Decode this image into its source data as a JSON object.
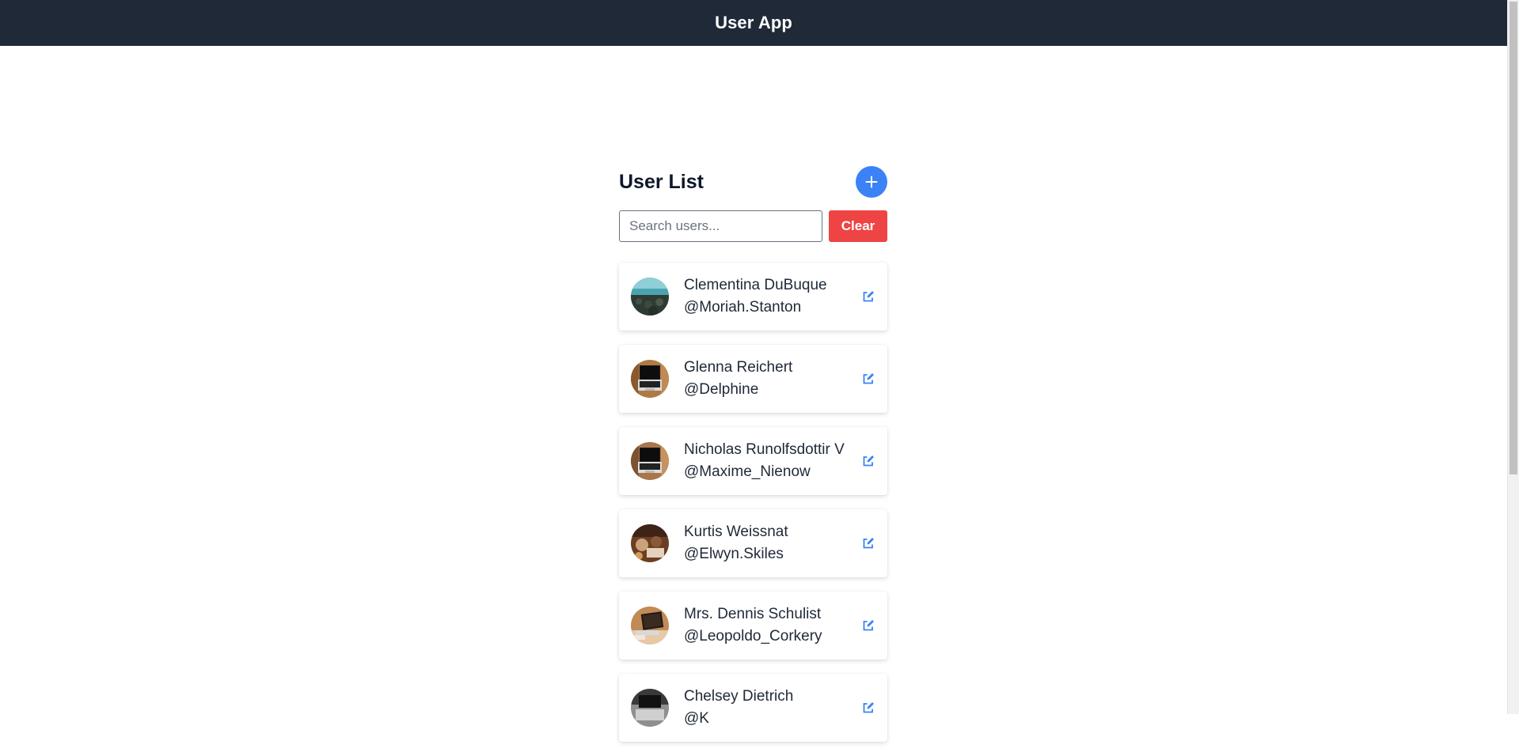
{
  "header": {
    "title": "User App"
  },
  "main": {
    "title": "User List",
    "add_label": "+",
    "search": {
      "placeholder": "Search users...",
      "value": ""
    },
    "clear_label": "Clear",
    "users": [
      {
        "name": "Clementina DuBuque",
        "handle": "@Moriah.Stanton",
        "avatar": "landscape-photo"
      },
      {
        "name": "Glenna Reichert",
        "handle": "@Delphine",
        "avatar": "laptop-photo"
      },
      {
        "name": "Nicholas Runolfsdottir V",
        "handle": "@Maxime_Nienow",
        "avatar": "laptop-photo"
      },
      {
        "name": "Kurtis Weissnat",
        "handle": "@Elwyn.Skiles",
        "avatar": "desk-photo"
      },
      {
        "name": "Mrs. Dennis Schulist",
        "handle": "@Leopoldo_Corkery",
        "avatar": "laptop-desk-photo"
      },
      {
        "name": "Chelsey Dietrich",
        "handle": "@K",
        "avatar": "laptop-photo"
      }
    ]
  },
  "colors": {
    "header_bg": "#1f2937",
    "accent": "#3b82f6",
    "danger": "#ef4444"
  },
  "icons": {
    "add": "plus-icon",
    "edit": "edit-icon"
  }
}
